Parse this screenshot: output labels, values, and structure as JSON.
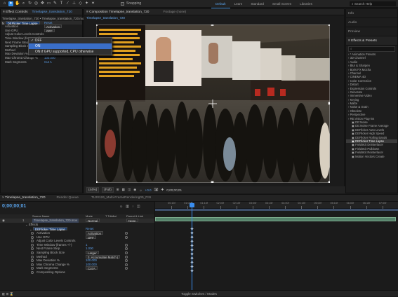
{
  "topbar": {
    "snapping": "Snapping",
    "workspaces": [
      "Default",
      "Learn",
      "Standard",
      "Small Screen",
      "Libraries"
    ],
    "active_workspace": "Default",
    "search_placeholder": "Search Help"
  },
  "effect_controls": {
    "tabs": [
      "Effect Controls",
      "Timelapse_translation_720"
    ],
    "breadcrumb": "Timelapse_translation_720 • Timelapse_translation_720.mov",
    "effect_name": "DEFlicker Time Lapse",
    "reset": "Reset",
    "rows": [
      {
        "label": "Activation",
        "value": "Activation"
      },
      {
        "label": "Use GPU",
        "value": "OFF"
      },
      {
        "label": "Adjust Color Levels Controls",
        "value": ""
      },
      {
        "label": "Time Window (frames +/-)",
        "value": ""
      },
      {
        "label": "Next Frame Step",
        "value": ""
      },
      {
        "label": "Sampling Block Size",
        "value": ""
      },
      {
        "label": "Method",
        "value": "3. Accumulate Multi"
      },
      {
        "label": "Max Deviation %",
        "value": "100.000"
      },
      {
        "label": "Max Chroma Change %",
        "value": "100.000"
      },
      {
        "label": "Mark Segments",
        "value": "Cut A"
      }
    ],
    "dropdown": {
      "options": [
        "OFF",
        "ON",
        "ON if GPU supported, CPU otherwise"
      ],
      "checked": "OFF",
      "highlighted": "ON"
    }
  },
  "composition": {
    "tabs": [
      "Composition  Timelapse_translation_720",
      "Footage (none)"
    ],
    "tab_sub": "Timelapse_translation_720",
    "zoom": "(44%)",
    "quality": "(Full)",
    "exposure": "+0.0",
    "timecode": "0;00;00;01"
  },
  "right_panel": {
    "sections": [
      "Info",
      "Audio",
      "Preview"
    ],
    "effects_title": "Effects & Presets",
    "search_placeholder": "",
    "items": [
      {
        "label": "* Animation Presets",
        "sub": false,
        "selected": false
      },
      {
        "label": "3D Channel",
        "sub": false,
        "selected": false
      },
      {
        "label": "Audio",
        "sub": false,
        "selected": false
      },
      {
        "label": "Blur & Sharpen",
        "sub": false,
        "selected": false
      },
      {
        "label": "Boris FX Mocha",
        "sub": false,
        "selected": false
      },
      {
        "label": "Channel",
        "sub": false,
        "selected": false
      },
      {
        "label": "CINEMA 4D",
        "sub": false,
        "selected": false
      },
      {
        "label": "Color Correction",
        "sub": false,
        "selected": false
      },
      {
        "label": "Distort",
        "sub": false,
        "selected": false
      },
      {
        "label": "Expression Controls",
        "sub": false,
        "selected": false
      },
      {
        "label": "Generate",
        "sub": false,
        "selected": false
      },
      {
        "label": "Immersive Video",
        "sub": false,
        "selected": false
      },
      {
        "label": "Keying",
        "sub": false,
        "selected": false
      },
      {
        "label": "Matte",
        "sub": false,
        "selected": false
      },
      {
        "label": "Noise & Grain",
        "sub": false,
        "selected": false
      },
      {
        "label": "Obsolete",
        "sub": false,
        "selected": false
      },
      {
        "label": "Perspective",
        "sub": false,
        "selected": false
      },
      {
        "label": "RE:Vision Plug-ins",
        "sub": false,
        "selected": false
      },
      {
        "label": "DE:Noise",
        "sub": true,
        "selected": false
      },
      {
        "label": "DE:Noise Frame Average",
        "sub": true,
        "selected": false
      },
      {
        "label": "DEFlicker Auto Levels",
        "sub": true,
        "selected": false
      },
      {
        "label": "DEFlicker High Speed",
        "sub": true,
        "selected": false
      },
      {
        "label": "DEFlicker Rolling Bands",
        "sub": true,
        "selected": false
      },
      {
        "label": "DEFlicker Time Lapse",
        "sub": true,
        "selected": true
      },
      {
        "label": "FieldsKit Deinterlacer",
        "sub": true,
        "selected": false
      },
      {
        "label": "FieldsKit Pulldown",
        "sub": true,
        "selected": false
      },
      {
        "label": "FieldsKit Reinterlacer",
        "sub": true,
        "selected": false
      },
      {
        "label": "Motion Vectors Create",
        "sub": true,
        "selected": false
      }
    ]
  },
  "timeline": {
    "tabs": [
      "Timelapse_translation_720",
      "Render Queue",
      "TL00126_Multi-FrameRendering05_FIN"
    ],
    "timecode": "0;00;00;01",
    "columns": [
      "Source Name",
      "Mode",
      "T TrkMat",
      "Parent & Link"
    ],
    "layer": {
      "num": "1",
      "name": "Timelapse_translation_720.mov",
      "mode": "Normal",
      "parent": "None"
    },
    "effects_label": "Effects",
    "effect_name": "DEFlicker Time Lapse",
    "reset": "Reset",
    "props": [
      {
        "label": "Activation",
        "value": "Activation"
      },
      {
        "label": "Use GPU",
        "value": "OFF"
      },
      {
        "label": "Adjust Color Levels Controls",
        "value": ""
      },
      {
        "label": "Time Window (frames +/-)",
        "value": "1"
      },
      {
        "label": "Next Frame Step",
        "value": "1.000"
      },
      {
        "label": "Sampling Block Size",
        "value": "Larger"
      },
      {
        "label": "Method",
        "value": "3. Accumulate Match ("
      },
      {
        "label": "Max Deviation %",
        "value": "100.000"
      },
      {
        "label": "Max Chroma Change %",
        "value": "100.000"
      },
      {
        "label": "Mark Segments",
        "value": "Cut A"
      },
      {
        "label": "Compositing Options",
        "value": ""
      }
    ],
    "ruler_labels": [
      "00:15f",
      "01:00f",
      "01:15f",
      "02:00f",
      "02:15f",
      "03:00f",
      "03:15f",
      "04:00f",
      "04:15f",
      "05:00f",
      "05:15f",
      "06:00f",
      "06:15f",
      "07:00f"
    ],
    "bottom_label": "Toggle Switches / Modes"
  }
}
